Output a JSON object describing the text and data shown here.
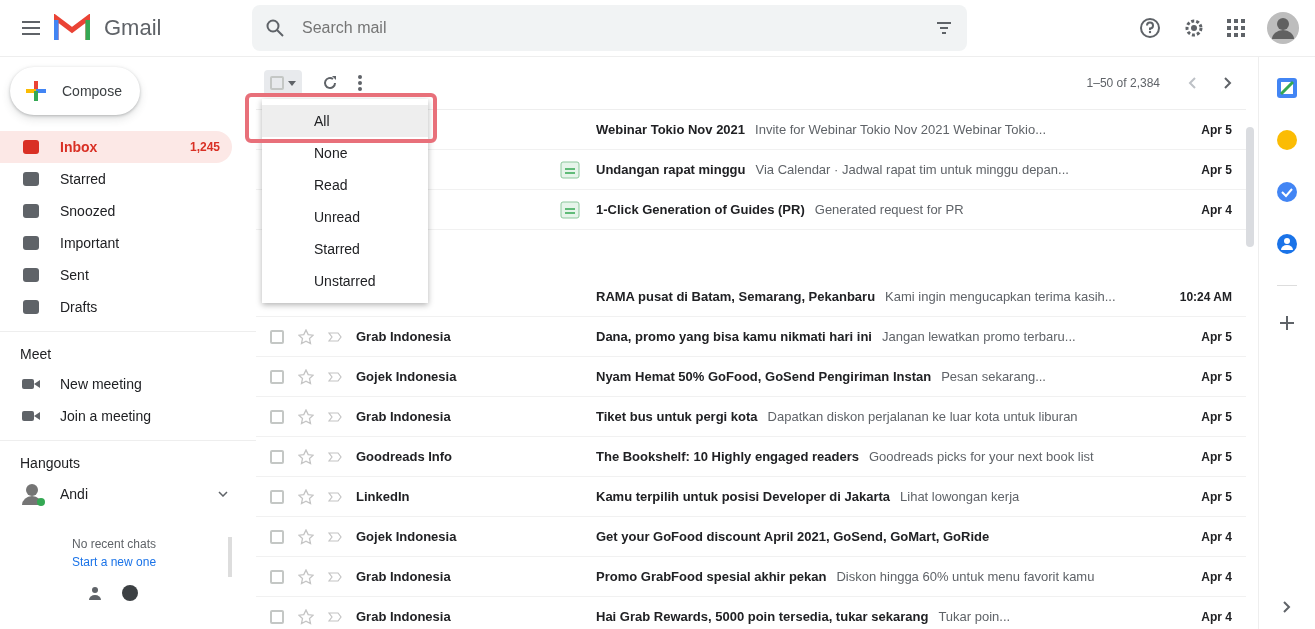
{
  "app": {
    "name": "Gmail"
  },
  "search": {
    "placeholder": "Search mail"
  },
  "compose": {
    "label": "Compose"
  },
  "sidebar": {
    "items": [
      {
        "label": "Inbox",
        "count": "1,245",
        "selected": true
      },
      {
        "label": "Starred",
        "selected": false
      },
      {
        "label": "Snoozed",
        "selected": false
      },
      {
        "label": "Important",
        "selected": false
      },
      {
        "label": "Sent",
        "selected": false
      },
      {
        "label": "Drafts",
        "selected": false
      }
    ]
  },
  "meet": {
    "title": "Meet",
    "items": [
      "New meeting",
      "Join a meeting"
    ]
  },
  "hangouts": {
    "title": "Hangouts",
    "user": "Andi",
    "empty_text": "No recent chats",
    "start_link": "Start a new one"
  },
  "toolbar": {
    "select_checked": false,
    "pagination": "1–50 of 2,384"
  },
  "select_menu": {
    "items": [
      {
        "label": "All",
        "selected": true
      },
      {
        "label": "None",
        "selected": false
      },
      {
        "label": "Read",
        "selected": false
      },
      {
        "label": "Unread",
        "selected": false
      },
      {
        "label": "Starred",
        "selected": false
      },
      {
        "label": "Unstarred",
        "selected": false
      }
    ]
  },
  "sections": [
    {
      "rows": [
        {
          "subject": "Webinar Tokio Nov 2021",
          "snippet": "Invite for Webinar Tokio Nov 2021 Webinar Tokio...",
          "date": "Apr 5",
          "label_icon": false
        },
        {
          "subject": "Undangan rapat minggu",
          "snippet": "Via Calendar · Jadwal rapat tim untuk minggu depan...",
          "date": "Apr 5",
          "label_icon": true
        },
        {
          "subject": "1-Click Generation of Guides (PR)",
          "snippet": "Generated request for PR",
          "date": "Apr 4",
          "label_icon": true
        }
      ]
    },
    {
      "rows": [
        {
          "subject": "RAMA pusat di Batam, Semarang, Pekanbaru",
          "snippet": "Kami ingin mengucapkan terima kasih...",
          "date": "10:24 AM",
          "label_icon": false
        },
        {
          "sender": "Grab Indonesia",
          "subject": "Dana, promo yang bisa kamu nikmati hari ini",
          "snippet": "Jangan lewatkan promo terbaru...",
          "date": "Apr 5",
          "label_icon": false,
          "checked": false
        },
        {
          "sender": "Gojek Indonesia",
          "subject": "Nyam Hemat 50% GoFood, GoSend Pengiriman Instan",
          "snippet": "Pesan sekarang...",
          "date": "Apr 5",
          "label_icon": false,
          "checked": false
        },
        {
          "sender": "Grab Indonesia",
          "subject": "Tiket bus untuk pergi kota",
          "snippet": "Dapatkan diskon perjalanan ke luar kota untuk liburan",
          "date": "Apr 5",
          "label_icon": false,
          "checked": false
        },
        {
          "sender": "Goodreads Info",
          "subject": "The Bookshelf: 10 Highly engaged readers",
          "snippet": "Goodreads picks for your next book list",
          "date": "Apr 5",
          "label_icon": false,
          "checked": false
        },
        {
          "sender": "LinkedIn",
          "subject": "Kamu terpilih untuk posisi Developer di Jakarta",
          "snippet": "Lihat lowongan kerja",
          "date": "Apr 5",
          "label_icon": false,
          "checked": false
        },
        {
          "sender": "Gojek Indonesia",
          "subject": "Get your GoFood discount April 2021, GoSend, GoMart, GoRide",
          "date": "Apr 4",
          "label_icon": false,
          "checked": false
        },
        {
          "sender": "Grab Indonesia",
          "subject": "Promo GrabFood spesial akhir pekan",
          "snippet": "Diskon hingga 60% untuk menu favorit kamu",
          "date": "Apr 4",
          "label_icon": false,
          "checked": false
        },
        {
          "sender": "Grab Indonesia",
          "subject": "Hai Grab Rewards, 5000 poin tersedia, tukar sekarang",
          "snippet": "Tukar poin...",
          "date": "Apr 4",
          "label_icon": false,
          "checked": false
        }
      ]
    }
  ]
}
